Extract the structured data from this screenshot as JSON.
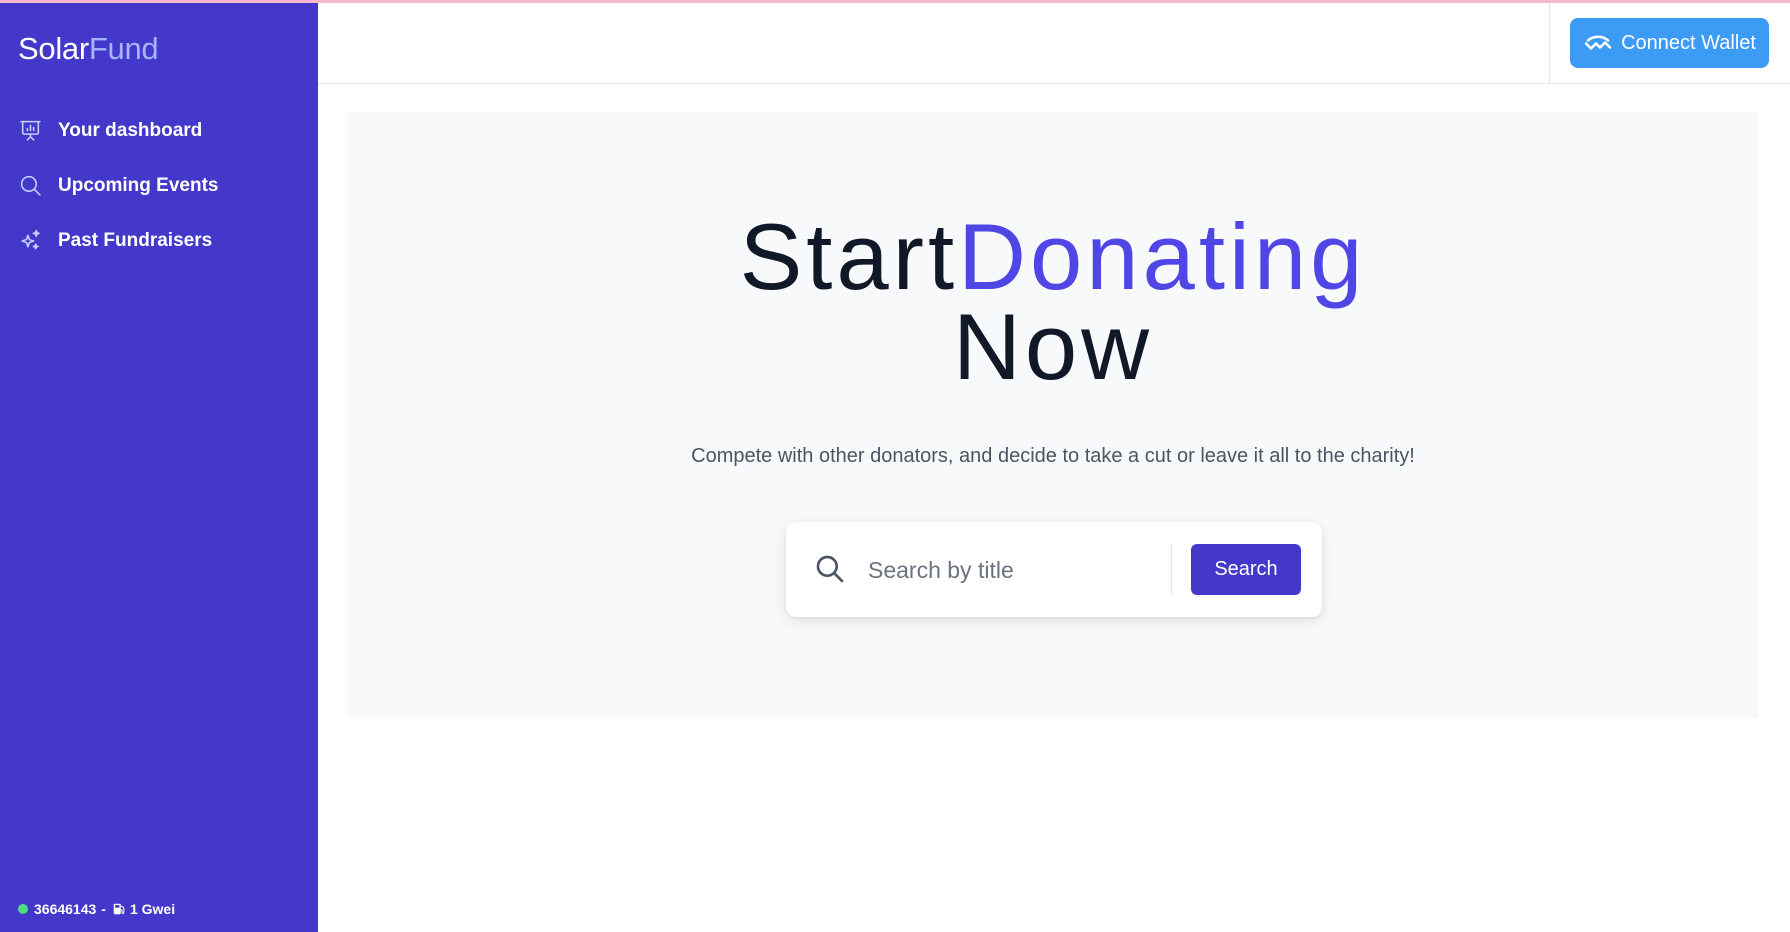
{
  "brand": {
    "part1": "Solar",
    "part2": "Fund"
  },
  "sidebar": {
    "items": [
      {
        "label": "Your dashboard",
        "icon": "presentation-chart-icon"
      },
      {
        "label": "Upcoming Events",
        "icon": "search-icon"
      },
      {
        "label": "Past Fundraisers",
        "icon": "sparkles-icon"
      }
    ],
    "footer": {
      "block": "36646143",
      "separator": "-",
      "gas": "1 Gwei",
      "status_color": "#4ade80"
    }
  },
  "header": {
    "connect_label": "Connect Wallet"
  },
  "hero": {
    "title_part1": "Start",
    "title_part2": "Donating",
    "title_part3": "Now",
    "subtitle": "Compete with other donators, and decide to take a cut or leave it all to the charity!"
  },
  "search": {
    "placeholder": "Search by title",
    "value": "",
    "button_label": "Search"
  },
  "colors": {
    "sidebar": "#4338ca",
    "accent": "#4f46e5",
    "connect_button": "#3b9bf5",
    "hero_bg": "#f8f9fb"
  }
}
